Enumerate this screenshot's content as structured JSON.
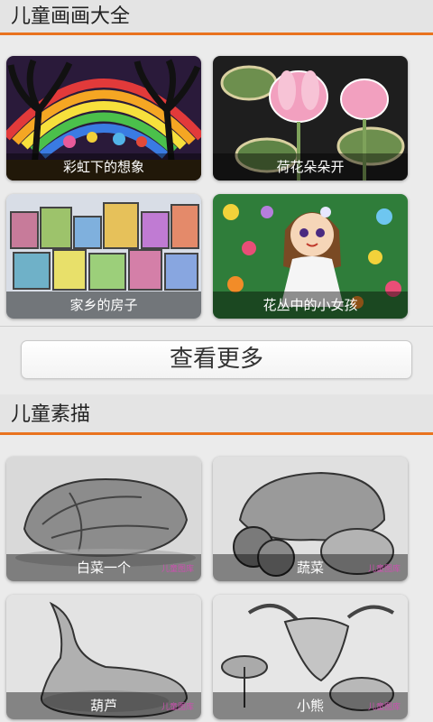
{
  "section1": {
    "title": "儿童画画大全",
    "cards": [
      {
        "caption": "彩虹下的想象"
      },
      {
        "caption": "荷花朵朵开"
      },
      {
        "caption": "家乡的房子"
      },
      {
        "caption": "花丛中的小女孩"
      }
    ]
  },
  "more_button": {
    "label": "查看更多"
  },
  "section2": {
    "title": "儿童素描",
    "cards": [
      {
        "caption": "白菜一个",
        "watermark": "儿童图库"
      },
      {
        "caption": "蔬菜",
        "watermark": "儿童图库"
      },
      {
        "caption": "葫芦",
        "watermark": "儿童图库"
      },
      {
        "caption": "小熊",
        "watermark": "儿童图库"
      }
    ]
  },
  "colors": {
    "accent": "#e9731f",
    "header_bg": "#e4e4e4",
    "page_bg": "#ebebeb"
  }
}
